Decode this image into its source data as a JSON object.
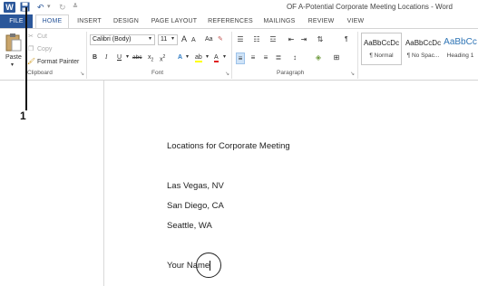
{
  "window": {
    "title": "OF A-Potential Corporate Meeting Locations - Word"
  },
  "qat": {
    "logo": "W",
    "undo": "↶",
    "redo": "↻"
  },
  "tabs": [
    "FILE",
    "HOME",
    "INSERT",
    "DESIGN",
    "PAGE LAYOUT",
    "REFERENCES",
    "MAILINGS",
    "REVIEW",
    "VIEW"
  ],
  "clipboard": {
    "paste": "Paste",
    "cut": "Cut",
    "copy": "Copy",
    "format_painter": "Format Painter",
    "label": "Clipboard"
  },
  "font": {
    "name": "Calibri (Body)",
    "size": "11",
    "label": "Font",
    "grow": "A",
    "shrink": "A",
    "case": "Aa",
    "bold": "B",
    "italic": "I",
    "underline": "U",
    "strike": "abc",
    "sub": "x",
    "sup": "x"
  },
  "paragraph": {
    "label": "Paragraph",
    "pilcrow": "¶"
  },
  "styles": [
    {
      "sample": "AaBbCcDc",
      "name": "¶ Normal"
    },
    {
      "sample": "AaBbCcDc",
      "name": "¶ No Spac..."
    },
    {
      "sample": "AaBbCc",
      "name": "Heading 1"
    }
  ],
  "callout": {
    "number": "1"
  },
  "document": {
    "lines": [
      "Locations for Corporate Meeting",
      "Las Vegas, NV",
      "San Diego, CA",
      "Seattle, WA",
      "Your Name"
    ]
  },
  "colors": {
    "accent": "#2b579a"
  }
}
